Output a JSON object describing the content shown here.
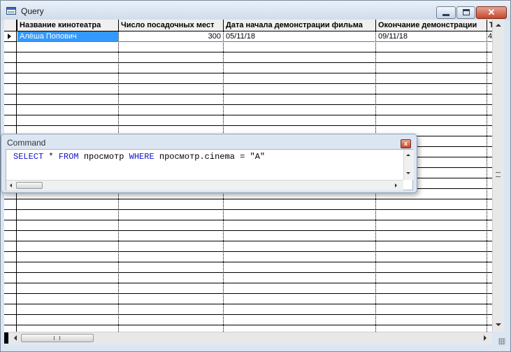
{
  "window": {
    "title": "Query",
    "minimize_symbol": "",
    "close_symbol": "✕"
  },
  "grid": {
    "columns": [
      "Название кинотеатра",
      "Число посадочных мест",
      "Дата начала демонстрации фильма",
      "Окончание демонстрации",
      "Т"
    ],
    "rows": [
      {
        "cinema": "Алёша Попович",
        "seats": "300",
        "start_date": "05/11/18",
        "end_date": "09/11/18",
        "extra": "4"
      }
    ]
  },
  "command": {
    "title": "Command",
    "close_symbol": "x",
    "tokens": [
      {
        "text": "SELECT",
        "kw": true
      },
      {
        "text": " * ",
        "kw": false
      },
      {
        "text": "FROM",
        "kw": true
      },
      {
        "text": " просмотр ",
        "kw": false
      },
      {
        "text": "WHERE",
        "kw": true
      },
      {
        "text": " просмотр.cinema = \"A\"",
        "kw": false
      }
    ]
  },
  "colors": {
    "selection": "#3399ff",
    "keyword": "#1414c8",
    "close_button": "#c7462c"
  }
}
